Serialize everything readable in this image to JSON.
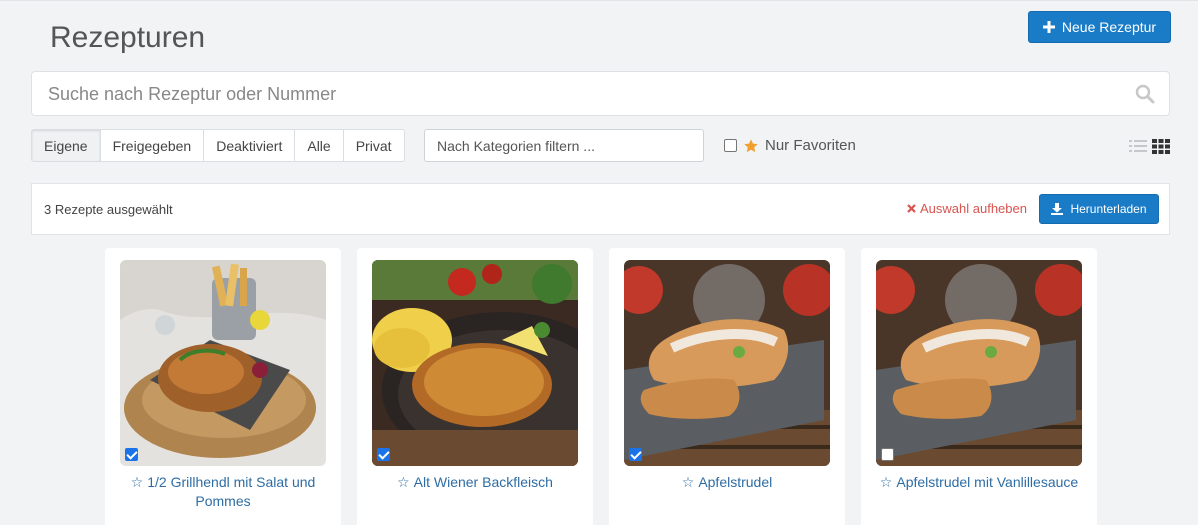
{
  "header": {
    "title": "Rezepturen",
    "new_button": "Neue Rezeptur"
  },
  "search": {
    "placeholder": "Suche nach Rezeptur oder Nummer"
  },
  "filters": {
    "tabs": [
      "Eigene",
      "Freigegeben",
      "Deaktiviert",
      "Alle",
      "Privat"
    ],
    "active": "Eigene",
    "category_placeholder": "Nach Kategorien filtern ...",
    "favorites_label": "Nur Favoriten",
    "favorites_checked": false
  },
  "selection": {
    "count_text": "3 Rezepte ausgewählt",
    "clear_label": "Auswahl aufheben",
    "download_label": "Herunterladen"
  },
  "recipes": [
    {
      "name": "1/2 Grillhendl mit Salat und Pommes",
      "selected": true,
      "image_icon": "roast-chicken-photo"
    },
    {
      "name": "Alt Wiener Backfleisch",
      "selected": true,
      "image_icon": "schnitzel-photo"
    },
    {
      "name": "Apfelstrudel",
      "selected": true,
      "image_icon": "apple-strudel-photo"
    },
    {
      "name": "Apfelstrudel mit Vanlillesauce",
      "selected": false,
      "image_icon": "apple-strudel-photo"
    }
  ],
  "colors": {
    "primary": "#1a7bc7",
    "link": "#2e6da4",
    "danger": "#d9534f",
    "favorite_star": "#f0a030"
  }
}
